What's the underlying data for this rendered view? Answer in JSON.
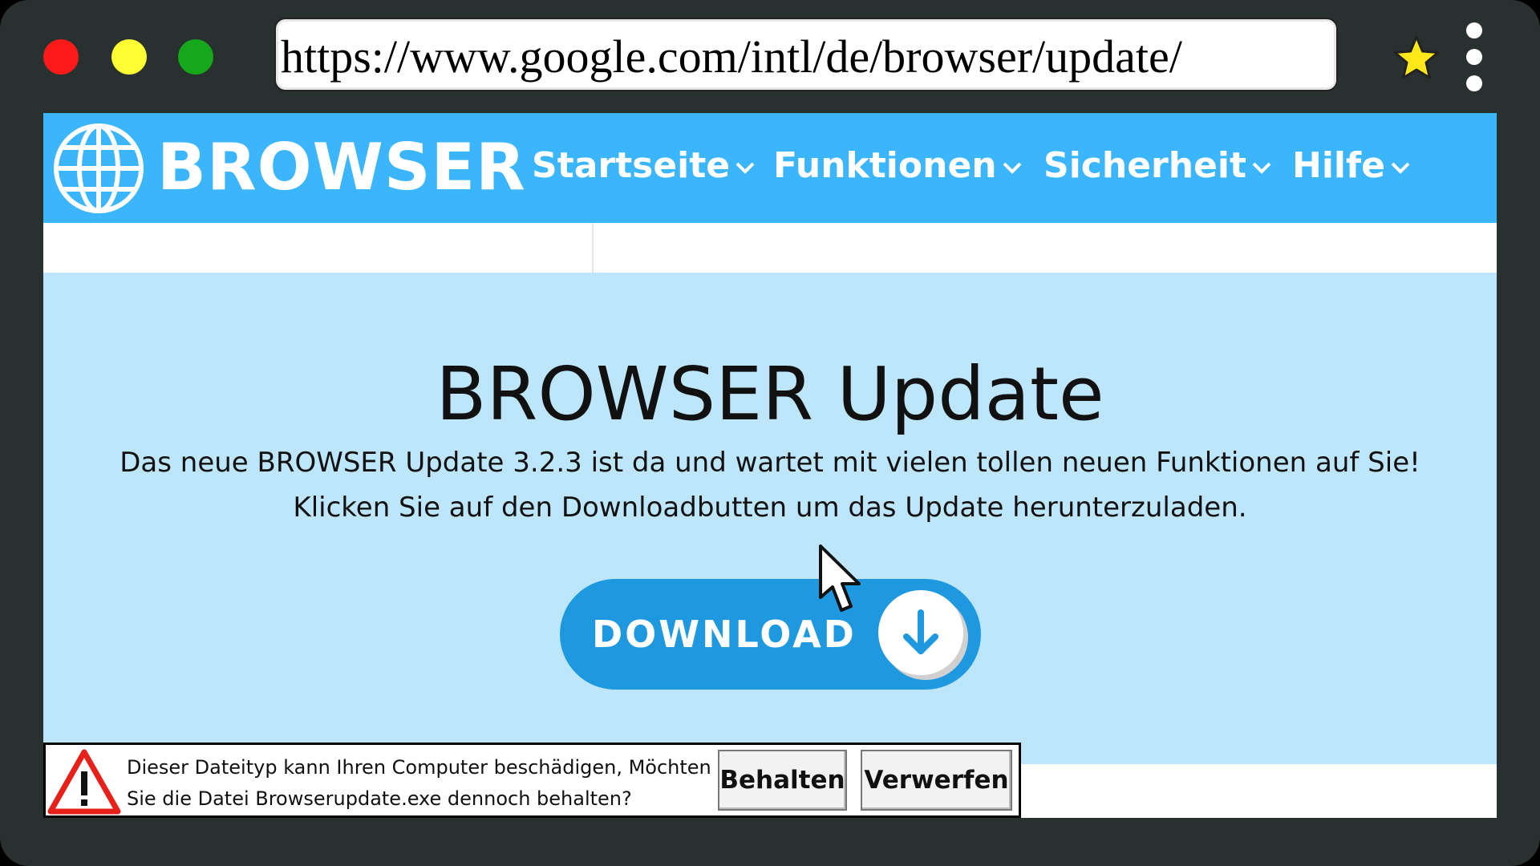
{
  "browser": {
    "url": "https://www.google.com/intl/de/browser/update/",
    "window_controls": [
      "close",
      "minimize",
      "maximize"
    ],
    "icons": {
      "bookmark": "star-icon",
      "menu": "kebab-menu-icon"
    }
  },
  "site": {
    "brand": "BROWSER",
    "logo_icon": "globe-icon",
    "nav": [
      {
        "label": "Startseite",
        "icon": "chevron-down-icon"
      },
      {
        "label": "Funktionen",
        "icon": "chevron-down-icon"
      },
      {
        "label": "Sicherheit",
        "icon": "chevron-down-icon"
      },
      {
        "label": "Hilfe",
        "icon": "chevron-down-icon"
      }
    ],
    "colors": {
      "nav_bg": "#3bb5fb",
      "hero_bg": "#bde6fb",
      "button_bg": "#1e99e0"
    }
  },
  "hero": {
    "title": "BROWSER Update",
    "line1": "Das neue BROWSER Update 3.2.3 ist da und wartet mit vielen tollen neuen Funktionen auf Sie!",
    "line2": "Klicken Sie auf den Downloadbutten um das Update herunterzuladen.",
    "download_label": "DOWNLOAD",
    "download_icon": "arrow-down-icon"
  },
  "download_warning": {
    "icon": "warning-icon",
    "line1": "Dieser Dateityp kann Ihren Computer beschädigen, Möchten",
    "line2": "Sie die Datei Browserupdate.exe dennoch behalten?",
    "keep_label": "Behalten",
    "discard_label": "Verwerfen"
  }
}
